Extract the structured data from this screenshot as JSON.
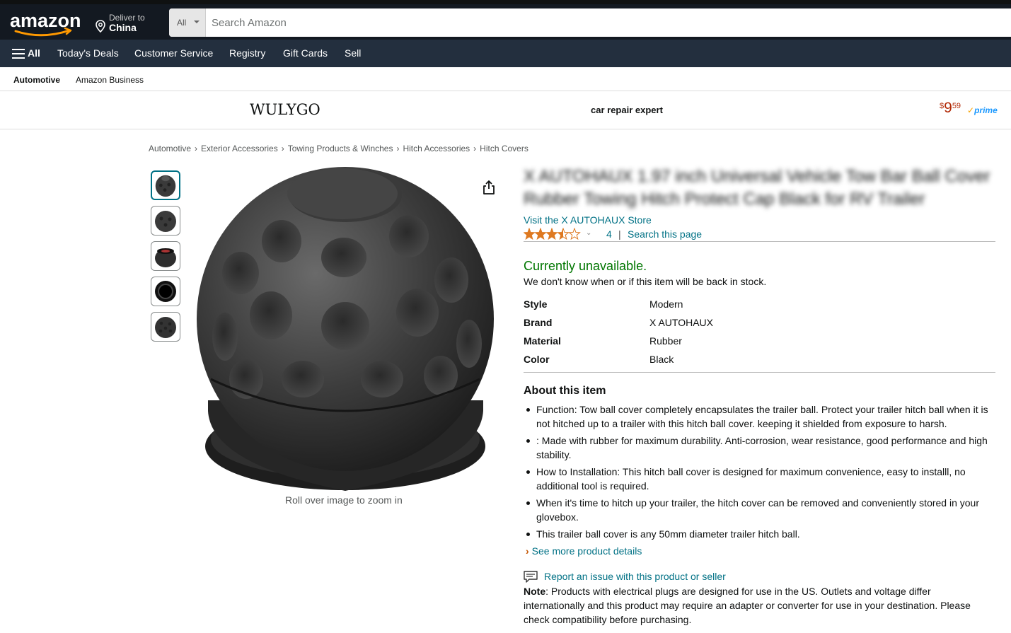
{
  "header": {
    "logo_text": "amazon",
    "deliver_label": "Deliver to",
    "deliver_location": "China",
    "search_category": "All",
    "search_placeholder": "Search Amazon"
  },
  "nav": {
    "all_label": "All",
    "items": [
      "Today's Deals",
      "Customer Service",
      "Registry",
      "Gift Cards",
      "Sell"
    ]
  },
  "subnav": {
    "items": [
      "Automotive",
      "Amazon Business"
    ]
  },
  "brand_bar": {
    "brand": "WULYGO",
    "tagline": "car repair expert",
    "price_symbol": "$",
    "price_whole": "9",
    "price_fraction": "59",
    "prime_label": "prime"
  },
  "breadcrumb": [
    "Automotive",
    "Exterior Accessories",
    "Towing Products & Winches",
    "Hitch Accessories",
    "Hitch Covers"
  ],
  "gallery": {
    "zoom_hint": "Roll over image to zoom in",
    "thumbnail_count": 5
  },
  "product": {
    "title": "X AUTOHAUX 1.97 inch Universal Vehicle Tow Bar Ball Cover Rubber Towing Hitch Protect Cap Black for RV Trailer",
    "store_link": "Visit the X AUTOHAUX Store",
    "rating": 3.5,
    "rating_count": "4",
    "separator": "|",
    "search_page": "Search this page",
    "availability": "Currently unavailable.",
    "availability_note": "We don't know when or if this item will be back in stock.",
    "specs": [
      {
        "label": "Style",
        "value": "Modern"
      },
      {
        "label": "Brand",
        "value": "X AUTOHAUX"
      },
      {
        "label": "Material",
        "value": "Rubber"
      },
      {
        "label": "Color",
        "value": "Black"
      }
    ],
    "about_heading": "About this item",
    "bullets": [
      "Function: Tow ball cover completely encapsulates the trailer ball. Protect your trailer hitch ball when it is not hitched up to a trailer with this hitch ball cover. keeping it shielded from exposure to harsh.",
      ": Made with rubber for maximum durability. Anti-corrosion, wear resistance, good performance and high stability.",
      "How to Installation: This hitch ball cover is designed for maximum convenience, easy to installl, no additional tool is required.",
      "When it's time to hitch up your trailer, the hitch cover can be removed and conveniently stored in your glovebox.",
      "This trailer ball cover is any 50mm diameter trailer hitch ball."
    ],
    "see_more": "See more product details",
    "report_issue": "Report an issue with this product or seller",
    "note_label": "Note",
    "note_text": ": Products with electrical plugs are designed for use in the US. Outlets and voltage differ internationally and this product may require an adapter or converter for use in your destination. Please check compatibility before purchasing."
  },
  "colors": {
    "nav_dark": "#131921",
    "nav_secondary": "#232f3e",
    "link": "#007185",
    "available_green": "#007600",
    "price_red": "#b12704",
    "star_orange": "#de7921"
  },
  "icons": {
    "location": "location-pin-icon",
    "share": "share-icon",
    "report": "report-comment-icon",
    "menu": "hamburger-menu-icon"
  }
}
